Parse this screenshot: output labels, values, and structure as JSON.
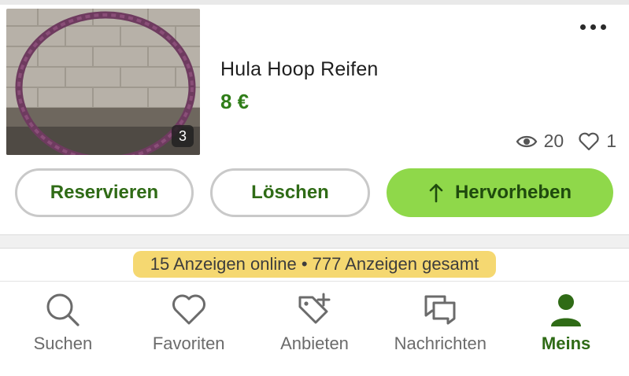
{
  "listing": {
    "title": "Hula Hoop Reifen",
    "price": "8 €",
    "photo_count": "3",
    "views": "20",
    "favorites": "1"
  },
  "actions": {
    "reserve_label": "Reservieren",
    "delete_label": "Löschen",
    "promote_label": "Hervorheben"
  },
  "summary": {
    "text": "15 Anzeigen online • 777 Anzeigen gesamt"
  },
  "tabs": [
    {
      "label": "Suchen",
      "icon": "search-icon"
    },
    {
      "label": "Favoriten",
      "icon": "heart-icon"
    },
    {
      "label": "Anbieten",
      "icon": "tag-plus-icon"
    },
    {
      "label": "Nachrichten",
      "icon": "chat-icon"
    },
    {
      "label": "Meins",
      "icon": "person-icon",
      "active": true
    }
  ],
  "colors": {
    "brand_green": "#2f7d18",
    "promote_bg": "#8fd84a",
    "highlight": "#f5d66a"
  }
}
